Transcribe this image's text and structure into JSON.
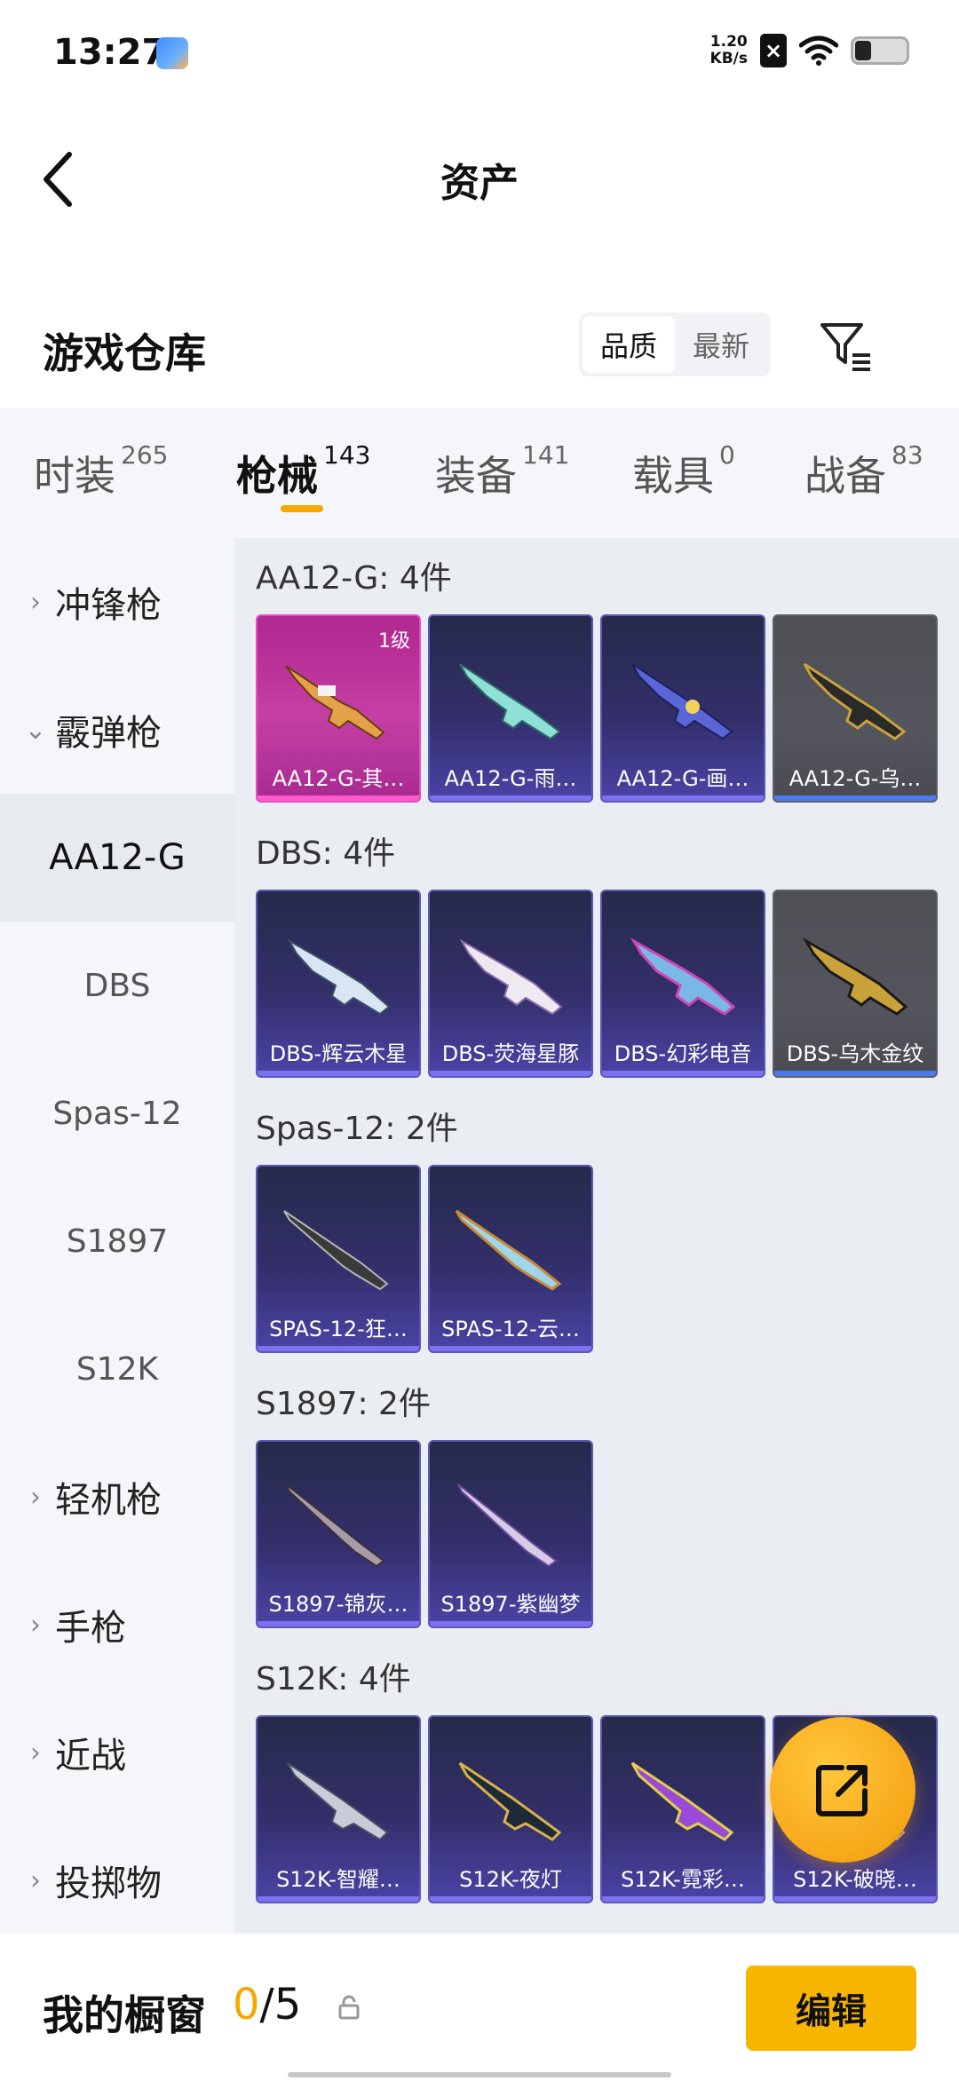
{
  "status_bar": {
    "time": "13:27",
    "net_speed_value": "1.20",
    "net_speed_unit": "KB/s",
    "icons": [
      "app-notification-icon",
      "sim-off-icon",
      "wifi-icon",
      "battery-icon"
    ]
  },
  "header": {
    "title": "资产",
    "back_icon": "chevron-left-icon"
  },
  "warehouse": {
    "title": "游戏仓库",
    "sort_options": [
      "品质",
      "最新"
    ],
    "sort_selected": "品质",
    "filter_icon": "filter-list-icon"
  },
  "tabs": [
    {
      "label": "时装",
      "count": "265"
    },
    {
      "label": "枪械",
      "count": "143",
      "active": true
    },
    {
      "label": "装备",
      "count": "141"
    },
    {
      "label": "载具",
      "count": "0"
    },
    {
      "label": "战备",
      "count": "83"
    }
  ],
  "sidebar": [
    {
      "label": "冲锋枪",
      "type": "category",
      "expanded": false
    },
    {
      "label": "霰弹枪",
      "type": "category",
      "expanded": true
    },
    {
      "label": "AA12-G",
      "type": "sub",
      "selected": true
    },
    {
      "label": "DBS",
      "type": "sub"
    },
    {
      "label": "Spas-12",
      "type": "sub"
    },
    {
      "label": "S1897",
      "type": "sub"
    },
    {
      "label": "S12K",
      "type": "sub"
    },
    {
      "label": "轻机枪",
      "type": "category",
      "expanded": false
    },
    {
      "label": "手枪",
      "type": "category",
      "expanded": false
    },
    {
      "label": "近战",
      "type": "category",
      "expanded": false
    },
    {
      "label": "投掷物",
      "type": "category",
      "expanded": false
    }
  ],
  "groups": [
    {
      "title": "AA12-G: 4件",
      "items": [
        {
          "name": "AA12-G-其…",
          "rarity": "pink",
          "level": "1级"
        },
        {
          "name": "AA12-G-雨…",
          "rarity": "purple"
        },
        {
          "name": "AA12-G-画…",
          "rarity": "purple"
        },
        {
          "name": "AA12-G-乌…",
          "rarity": "grey"
        }
      ]
    },
    {
      "title": "DBS: 4件",
      "items": [
        {
          "name": "DBS-辉云木星",
          "rarity": "purple"
        },
        {
          "name": "DBS-荧海星豚",
          "rarity": "purple"
        },
        {
          "name": "DBS-幻彩电音",
          "rarity": "purple"
        },
        {
          "name": "DBS-乌木金纹",
          "rarity": "grey"
        }
      ]
    },
    {
      "title": "Spas-12: 2件",
      "items": [
        {
          "name": "SPAS-12-狂…",
          "rarity": "purple"
        },
        {
          "name": "SPAS-12-云…",
          "rarity": "purple"
        }
      ]
    },
    {
      "title": "S1897: 2件",
      "items": [
        {
          "name": "S1897-锦灰…",
          "rarity": "purple"
        },
        {
          "name": "S1897-紫幽梦",
          "rarity": "purple"
        }
      ]
    },
    {
      "title": "S12K: 4件",
      "items": [
        {
          "name": "S12K-智耀…",
          "rarity": "purple"
        },
        {
          "name": "S12K-夜灯",
          "rarity": "purple"
        },
        {
          "name": "S12K-霓彩…",
          "rarity": "purple"
        },
        {
          "name": "S12K-破晓…",
          "rarity": "purple"
        }
      ]
    }
  ],
  "fab": {
    "icon": "share-export-icon"
  },
  "showcase": {
    "label": "我的橱窗",
    "used": "0",
    "separator": "/",
    "total": "5",
    "lock_icon": "lock-icon",
    "edit_label": "编辑"
  },
  "colors": {
    "accent": "#f5a800",
    "card_purple": "#4b43a6",
    "card_pink": "#c53fa4",
    "card_grey": "#55565d"
  }
}
